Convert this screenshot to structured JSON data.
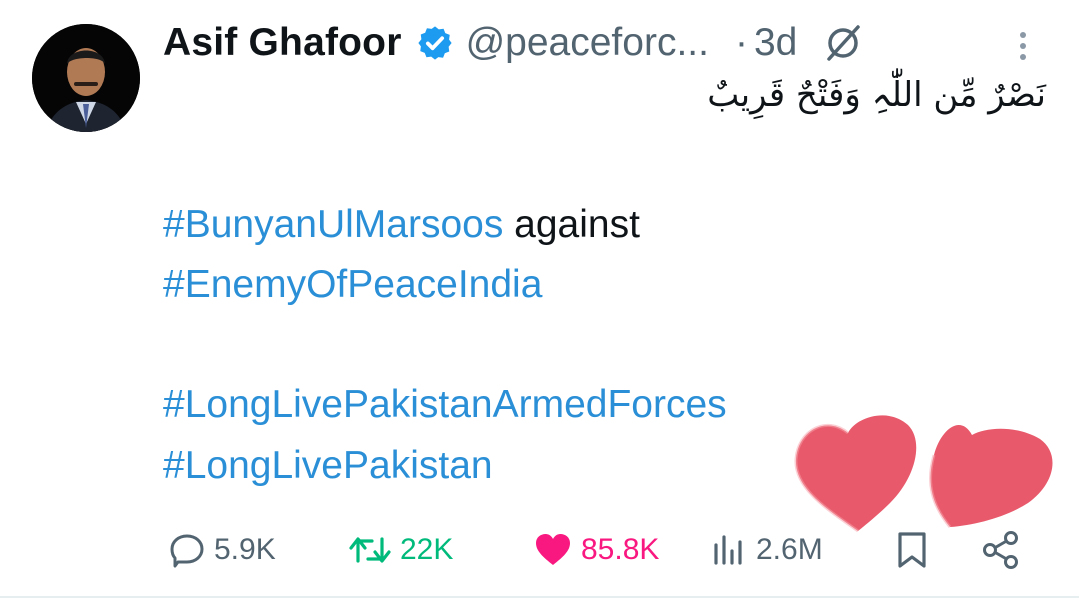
{
  "tweet": {
    "author": {
      "display_name": "Asif Ghafoor",
      "handle": "@peaceforc...",
      "verified": true
    },
    "separator": "·",
    "time": "3d",
    "arabic_line": "نَصْرٌ مِّن اللّٰہِ وَفَتْحٌ قَرِیبٌ",
    "lines": {
      "line1_hashtag": "#BunyanUlMarsoos",
      "line1_text": " against",
      "line2_hashtag": "#EnemyOfPeaceIndia",
      "line3_hashtag": "#LongLivePakistanArmedForces",
      "line4_hashtag": "#LongLivePakistan"
    }
  },
  "actions": {
    "replies": "5.9K",
    "retweets": "22K",
    "likes": "85.8K",
    "views": "2.6M"
  },
  "icons": {
    "reply": "reply-icon",
    "retweet": "retweet-icon",
    "like": "heart-filled-icon",
    "views": "views-icon",
    "bookmark": "bookmark-icon",
    "share": "share-icon",
    "verified": "verified-badge-icon",
    "grok": "grok-icon",
    "more": "more-vertical-icon"
  },
  "colors": {
    "hashtag": "#2a8fd6",
    "verified": "#1d9bf0",
    "retweet": "#00ba7c",
    "like": "#f91880",
    "muted": "#536471",
    "heart_sticker": "#e85a6b"
  }
}
